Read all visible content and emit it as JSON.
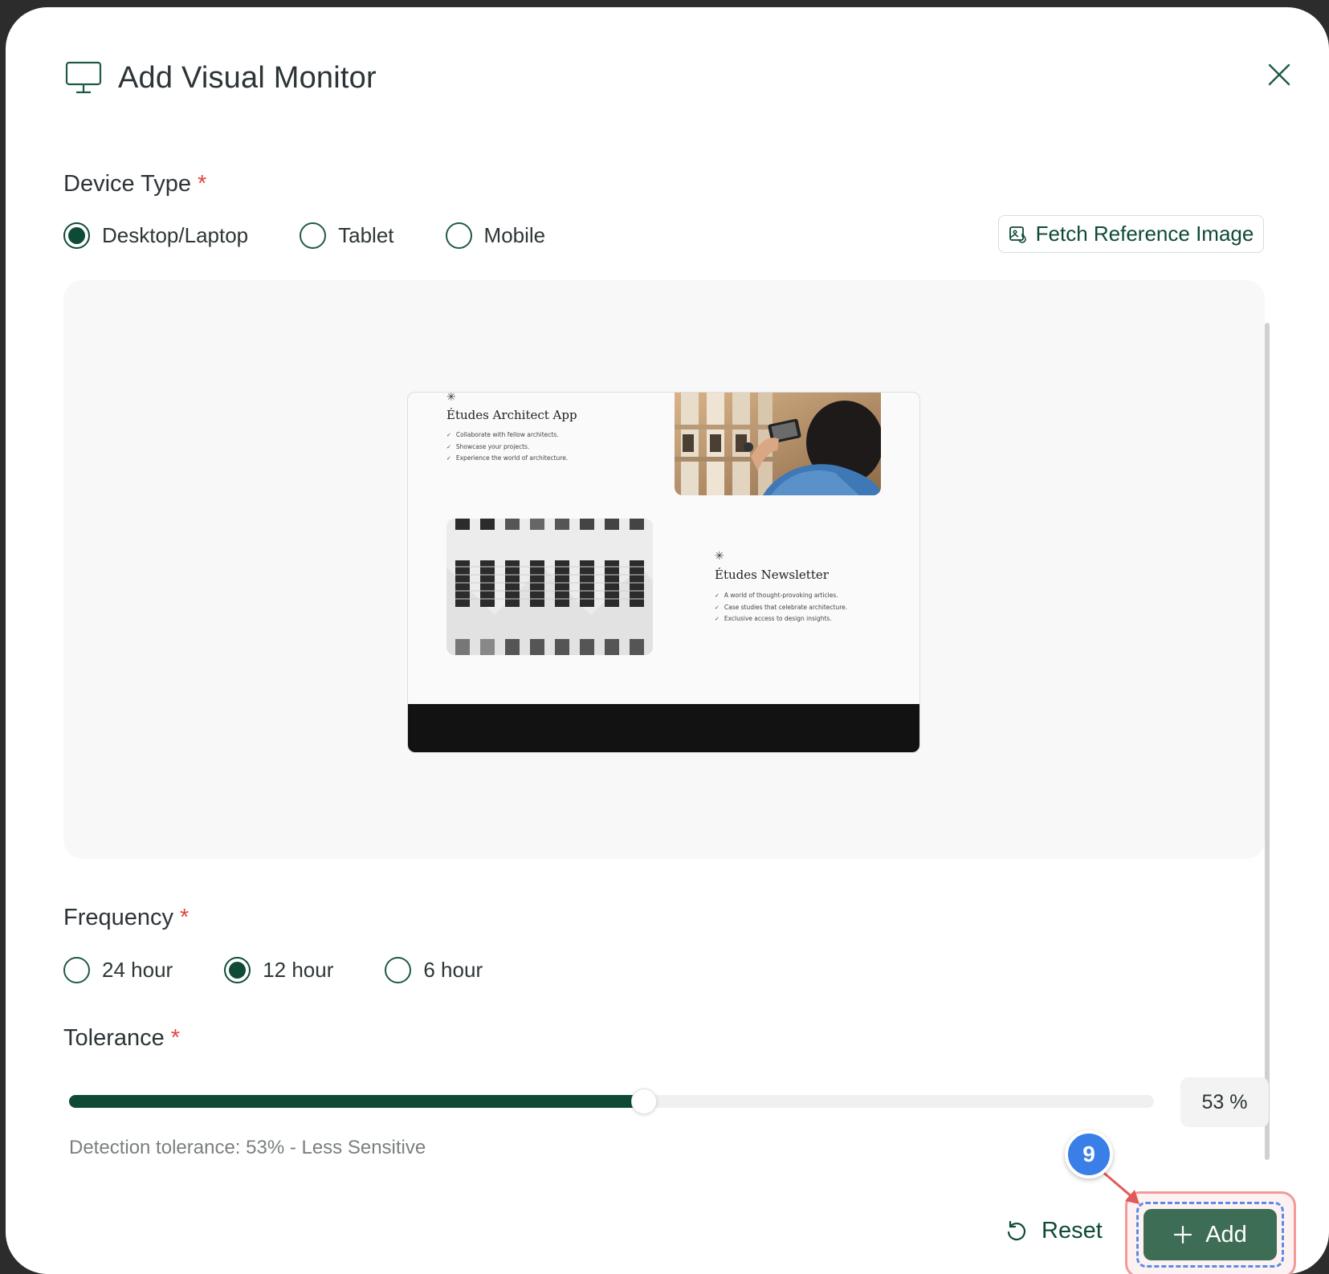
{
  "dialog": {
    "title": "Add Visual Monitor",
    "icon": "monitor-icon",
    "close_icon": "close-icon"
  },
  "device_type": {
    "label": "Device Type",
    "required_mark": "*",
    "options": [
      {
        "label": "Desktop/Laptop",
        "selected": true
      },
      {
        "label": "Tablet",
        "selected": false
      },
      {
        "label": "Mobile",
        "selected": false
      }
    ],
    "fetch_button": {
      "label": "Fetch Reference Image",
      "icon": "image-refresh-icon"
    }
  },
  "preview": {
    "block1": {
      "star": "✳",
      "title": "Études Architect App",
      "items": [
        "Collaborate with fellow architects.",
        "Showcase your projects.",
        "Experience the world of architecture."
      ]
    },
    "block2": {
      "star": "✳",
      "title": "Études Newsletter",
      "items": [
        "A world of thought-provoking articles.",
        "Case studies that celebrate architecture.",
        "Exclusive access to design insights."
      ]
    }
  },
  "frequency": {
    "label": "Frequency",
    "required_mark": "*",
    "options": [
      {
        "label": "24 hour",
        "selected": false
      },
      {
        "label": "12 hour",
        "selected": true
      },
      {
        "label": "6 hour",
        "selected": false
      }
    ]
  },
  "tolerance": {
    "label": "Tolerance",
    "required_mark": "*",
    "value": 53,
    "value_display": "53 %",
    "helper": "Detection tolerance: 53% - Less Sensitive"
  },
  "actions": {
    "reset_label": "Reset",
    "reset_icon": "reset-icon",
    "add_label": "Add",
    "add_icon": "plus-icon"
  },
  "annotation": {
    "step_number": "9"
  },
  "colors": {
    "accent": "#0f4a36",
    "add_button": "#3d6d55",
    "required": "#e1453d",
    "step_badge": "#3a7ee8",
    "highlight_border": "#f29a9a"
  }
}
